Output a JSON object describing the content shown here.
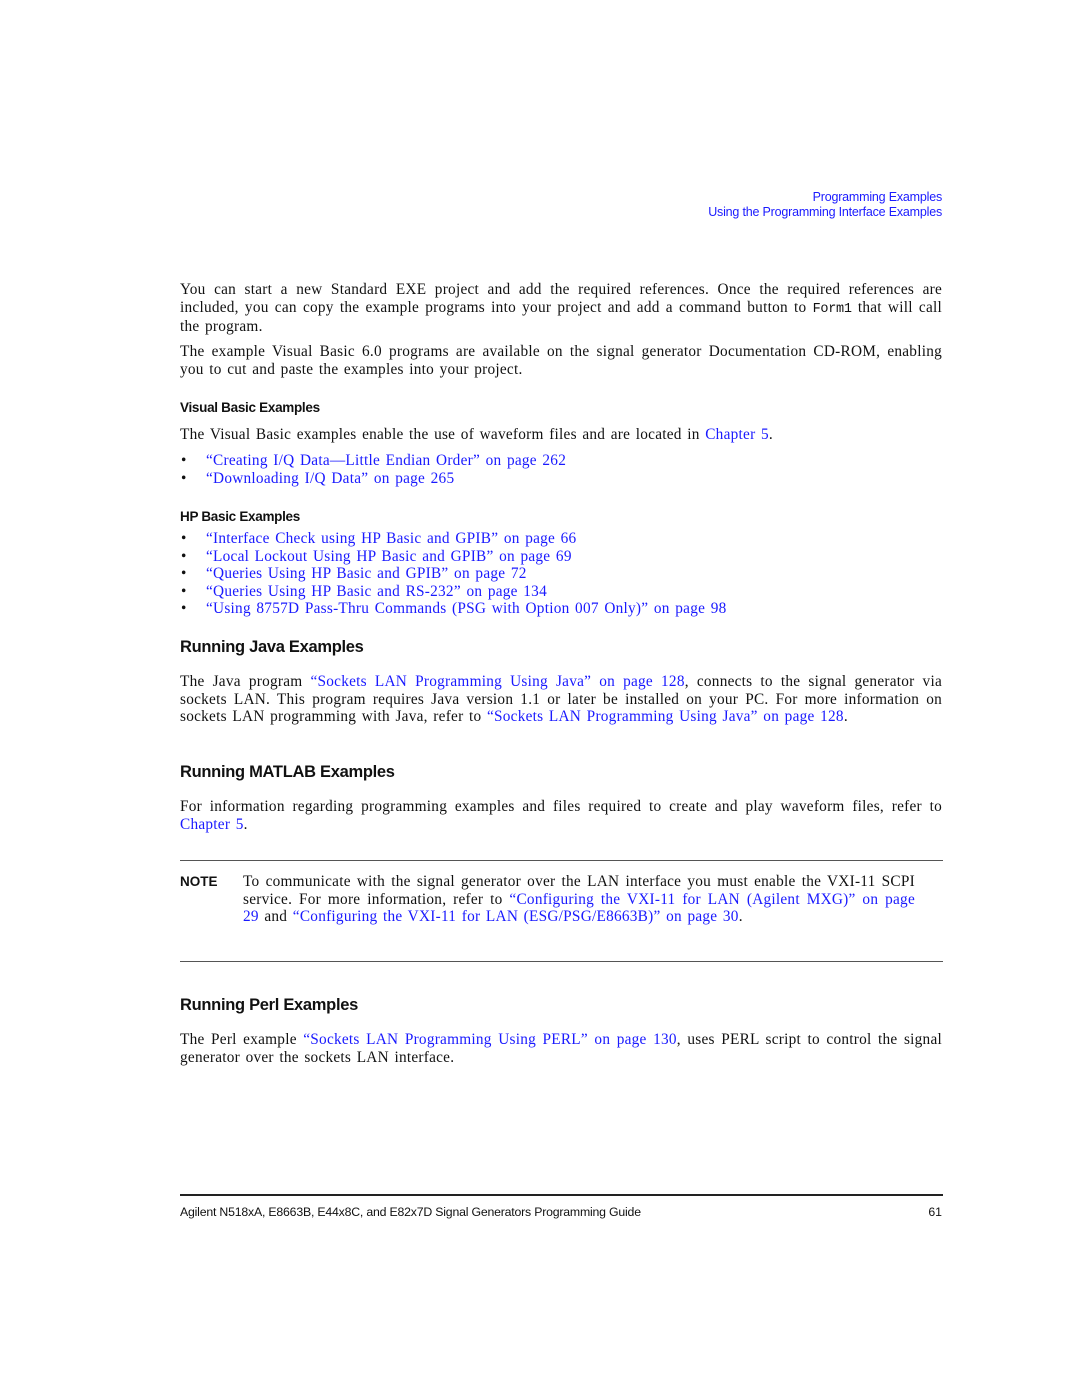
{
  "running_head": {
    "chapter": "Programming Examples",
    "section": "Using the Programming Interface Examples"
  },
  "intro": {
    "p1_a": "You can start a new Standard EXE project and add the required references. Once the required references are included, you can copy the example programs into your project and add a command button to ",
    "p1_code": "Form1",
    "p1_b": " that will call the program.",
    "p2": "The example Visual Basic 6.0 programs are available on the signal generator Documentation CD-ROM, enabling you to cut and paste the examples into your project."
  },
  "vb_section": {
    "heading": "Visual Basic Examples",
    "text_a": "The Visual Basic examples enable the use of waveform files and are located in ",
    "link": "Chapter 5",
    "text_b": ".",
    "items": [
      "“Creating I/Q Data—Little Endian Order” on page 262",
      "“Downloading I/Q Data” on page 265"
    ]
  },
  "hp_section": {
    "heading": "HP Basic Examples",
    "items": [
      "“Interface Check using HP Basic and GPIB” on page 66",
      "“Local Lockout Using HP Basic and GPIB” on page 69",
      "“Queries Using HP Basic and GPIB” on page 72",
      "“Queries Using HP Basic and RS-232” on page 134",
      "“Using 8757D Pass-Thru Commands (PSG with Option 007 Only)” on page 98"
    ]
  },
  "java_section": {
    "heading": "Running Java Examples",
    "text_a": "The Java program ",
    "link1": "“Sockets LAN Programming Using Java” on page 128",
    "text_b": ", connects to the signal generator via sockets LAN. This program requires Java version 1.1 or later be installed on your PC. For more information on sockets LAN programming with Java, refer to ",
    "link2": "“Sockets LAN Programming Using Java” on page 128",
    "text_c": "."
  },
  "matlab_section": {
    "heading": "Running MATLAB Examples",
    "text_a": "For information regarding programming examples and files required to create and play waveform files, refer to ",
    "link": "Chapter 5",
    "text_b": "."
  },
  "note": {
    "label": "NOTE",
    "text_a": "To communicate with the signal generator over the LAN interface you must enable the VXI-11 SCPI service. For more information, refer to ",
    "link1": "“Configuring the VXI-11 for LAN (Agilent MXG)” on page 29",
    "text_b": " and ",
    "link2": "“Configuring the VXI-11 for LAN (ESG/PSG/E8663B)” on page 30",
    "text_c": "."
  },
  "perl_section": {
    "heading": "Running Perl Examples",
    "text_a": "The Perl example ",
    "link": "“Sockets LAN Programming Using PERL” on page 130",
    "text_b": ", uses PERL script to control the signal generator over the sockets LAN interface."
  },
  "footer": {
    "title": "Agilent N518xA, E8663B, E44x8C, and E82x7D Signal Generators Programming Guide",
    "page_number": "61"
  },
  "colors": {
    "link": "#1a1aff",
    "text": "#111111"
  }
}
